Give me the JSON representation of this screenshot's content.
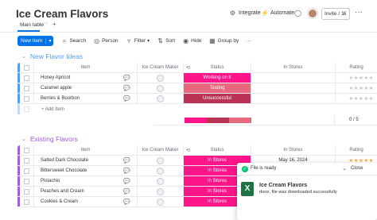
{
  "board": {
    "title": "Ice Cream Flavors"
  },
  "topbar": {
    "integrate": "Integrate",
    "automate": "Automate",
    "invite": "Invite / 1",
    "invite_count": "6"
  },
  "tabs": {
    "main": "Main table",
    "more": "···",
    "add": "+"
  },
  "toolbar": {
    "new_item": "New Item",
    "search": "Search",
    "person": "Person",
    "filter": "Filter",
    "sort": "Sort",
    "hide": "Hide",
    "group_by": "Group by"
  },
  "columns": {
    "item": "Item",
    "maker": "Ice Cream Maker",
    "status": "Status",
    "stores": "In Stores",
    "rating": "Rating"
  },
  "group1": {
    "title": "New Flavor Ideas",
    "color": "#579bfc",
    "rows": [
      {
        "name": "Honey Apricot",
        "status": "Working on it",
        "status_color": "#ff158a"
      },
      {
        "name": "Caramel apple",
        "status": "Testing",
        "status_color": "#e8697d"
      },
      {
        "name": "Berries & Bourbon",
        "status": "Unsuccessful",
        "status_color": "#bb3354"
      }
    ],
    "add_item": "+ Add Item",
    "rating_summary": "0 / 5"
  },
  "group2": {
    "title": "Existing Flavors",
    "color": "#a25ddc",
    "rows": [
      {
        "name": "Salted Dark Chocolate",
        "status": "In Stores",
        "status_color": "#ff158a",
        "stores": "May 16, 2024"
      },
      {
        "name": "Bittersweet Chocolate",
        "status": "In Stores",
        "status_color": "#ff158a",
        "stores": ""
      },
      {
        "name": "Pistachio",
        "status": "In Stores",
        "status_color": "#ff158a",
        "stores": ""
      },
      {
        "name": "Peaches and Cream",
        "status": "In Stores",
        "status_color": "#ff158a",
        "stores": ""
      },
      {
        "name": "Cookies & Cream",
        "status": "In Stores",
        "status_color": "#ff158a",
        "stores": ""
      }
    ]
  },
  "stars": "★★★★★",
  "popup": {
    "header": "File is ready",
    "close": "Close",
    "file_title": "Ice Cream Flavors",
    "file_sub": "done, file was downloaded successfully",
    "file_icon": "X"
  }
}
